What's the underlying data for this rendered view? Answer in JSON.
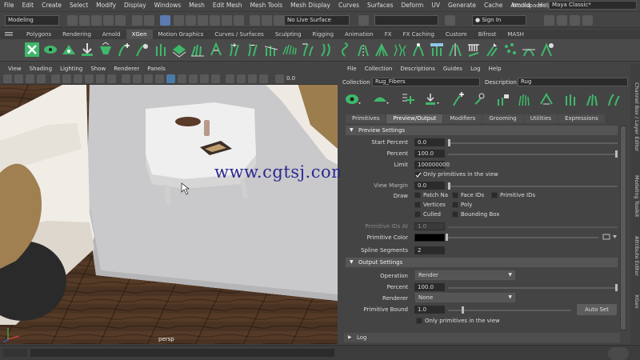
{
  "menubar": {
    "items": [
      "File",
      "Edit",
      "Create",
      "Select",
      "Modify",
      "Display",
      "Windows",
      "Mesh",
      "Edit Mesh",
      "Mesh Tools",
      "Mesh Display",
      "Curves",
      "Surfaces",
      "Deform",
      "UV",
      "Generate",
      "Cache",
      "Arnold",
      "Help"
    ],
    "workspace_label": "Workspace :",
    "workspace_value": "Maya Classic*"
  },
  "statusline": {
    "mode": "Modeling",
    "live_surface": "No Live Surface",
    "sign_in": "Sign In"
  },
  "shelf": {
    "tabs": [
      "Polygons",
      "Rendering",
      "Arnold",
      "XGen",
      "Motion Graphics",
      "Curves / Surfaces",
      "Sculpting",
      "Rigging",
      "Animation",
      "FX",
      "FX Caching",
      "Custom",
      "Bifrost",
      "MASH"
    ],
    "active_tab": "XGen"
  },
  "viewport": {
    "menu": [
      "View",
      "Shading",
      "Lighting",
      "Show",
      "Renderer",
      "Panels"
    ],
    "camera_label": "persp",
    "field_value": "0.0",
    "watermark": "www.cgtsj.com"
  },
  "xgen": {
    "menu": [
      "File",
      "Collection",
      "Descriptions",
      "Guides",
      "Log",
      "Help"
    ],
    "collection_label": "Collection",
    "collection_value": "Rug_Fibers",
    "description_label": "Description",
    "description_value": "Rug",
    "tabs": [
      "Primitives",
      "Preview/Output",
      "Modifiers",
      "Grooming",
      "Utilities",
      "Expressions"
    ],
    "active_tab": "Preview/Output",
    "preview_settings": {
      "header": "Preview Settings",
      "start_percent_label": "Start Percent",
      "start_percent": "0.0",
      "percent_label": "Percent",
      "percent": "100.0",
      "limit_label": "Limit",
      "limit": "100000000",
      "only_primitives_label": "Only primitives in the view",
      "view_margin_label": "View Margin",
      "view_margin": "0.0",
      "draw_label": "Draw",
      "draw_options": {
        "patch_na": "Patch Na",
        "face_ids": "Face IDs",
        "primitive_ids": "Primitive IDs",
        "vertices": "Vertices",
        "poly": "Poly",
        "culled": "Culled",
        "bounding_box": "Bounding Box"
      },
      "primitive_ids_at_label": "Primitive IDs At",
      "primitive_ids_at": "1.0",
      "primitive_color_label": "Primitive Color",
      "spline_segments_label": "Spline Segments",
      "spline_segments": "2"
    },
    "output_settings": {
      "header": "Output Settings",
      "operation_label": "Operation",
      "operation": "Render",
      "percent_label": "Percent",
      "percent": "100.0",
      "renderer_label": "Renderer",
      "renderer": "None",
      "primitive_bound_label": "Primitive Bound",
      "primitive_bound": "1.0",
      "auto_set": "Auto Set",
      "only_primitives_label": "Only primitives in the view"
    },
    "log_label": "Log"
  },
  "sidebar_tabs": [
    "Channel Box / Layer Editor",
    "Modeling Toolkit",
    "Attribute Editor",
    "XGen"
  ],
  "colors": {
    "panel_bg": "#444444",
    "field_bg": "#2b2b2b",
    "accent_green": "#3fb86b",
    "watermark": "#2a2a90"
  }
}
